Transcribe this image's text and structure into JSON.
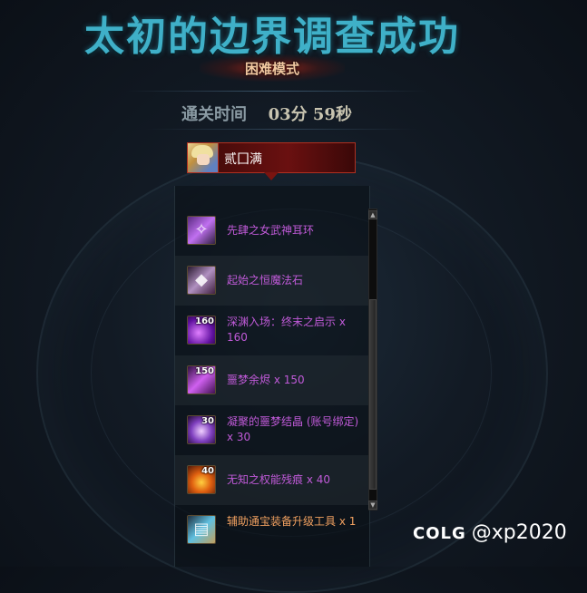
{
  "header": {
    "title": "太初的边界调查成功",
    "mode": "困难模式",
    "clear_time_label": "通关时间",
    "clear_time_value": "03分 59秒"
  },
  "player": {
    "name": "贰囗满"
  },
  "rewards": [
    {
      "name": "先肆之女武神耳环",
      "quantity": "",
      "icon": "earring-icon",
      "color": "#c05ad8",
      "rarity": "epic"
    },
    {
      "name": "起始之恒魔法石",
      "quantity": "",
      "icon": "magic-stone-icon",
      "color": "#c05ad8",
      "rarity": "epic"
    },
    {
      "name": "深渊入场：终末之启示 x 160",
      "quantity": "160",
      "icon": "abyss-ticket-icon",
      "color": "#c05ad8",
      "rarity": "epic"
    },
    {
      "name": "噩梦余烬 x 150",
      "quantity": "150",
      "icon": "nightmare-ember-icon",
      "color": "#c05ad8",
      "rarity": "epic"
    },
    {
      "name": "凝聚的噩梦结晶 (账号绑定) x 30",
      "quantity": "30",
      "icon": "nightmare-crystal-icon",
      "color": "#c05ad8",
      "rarity": "epic"
    },
    {
      "name": "无知之权能残痕 x 40",
      "quantity": "40",
      "icon": "power-trace-icon",
      "color": "#c05ad8",
      "rarity": "epic"
    },
    {
      "name": "辅助通宝装备升级工具 x 1",
      "quantity": "",
      "icon": "upgrade-tool-icon",
      "color": "#f0a060",
      "rarity": "legendary"
    }
  ],
  "watermark": {
    "logo": "COLG",
    "handle": "@xp2020"
  }
}
